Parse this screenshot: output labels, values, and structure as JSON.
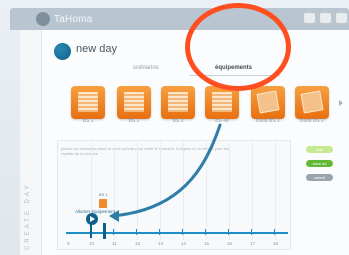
{
  "app": {
    "name": "TaHoma"
  },
  "scene": {
    "title": "new day"
  },
  "tabs": [
    {
      "label": "scénarios",
      "active": false
    },
    {
      "label": "équipements",
      "active": true
    }
  ],
  "devices": [
    {
      "label": "BS 1",
      "kind": "blind-icon"
    },
    {
      "label": "BS 2",
      "kind": "blind-icon"
    },
    {
      "label": "BS 3",
      "kind": "blind-icon"
    },
    {
      "label": "BS 4b",
      "kind": "blind-icon"
    },
    {
      "label": "Bsod BS 1",
      "kind": "tilted-blind-icon"
    },
    {
      "label": "Bsod BS 2",
      "kind": "tilted-blind-icon"
    }
  ],
  "timeline": {
    "help_text": "placez les scénarios dans la zone prévue pour créer le scénario. Indiquez ici un temps pour les répéter de la journée",
    "side_label": "CREATE DAY",
    "small_device_label": "BS 1",
    "action_label": "Allumer équipement",
    "ticks": [
      "9",
      "10",
      "11",
      "12",
      "13",
      "14",
      "15",
      "16",
      "17",
      "18"
    ]
  },
  "buttons": {
    "test": "test",
    "save": "save as",
    "cancel": "cancel"
  },
  "colors": {
    "annotation": "#ff4f21",
    "accent": "#1d8fc5",
    "device": "#f08a2a"
  }
}
